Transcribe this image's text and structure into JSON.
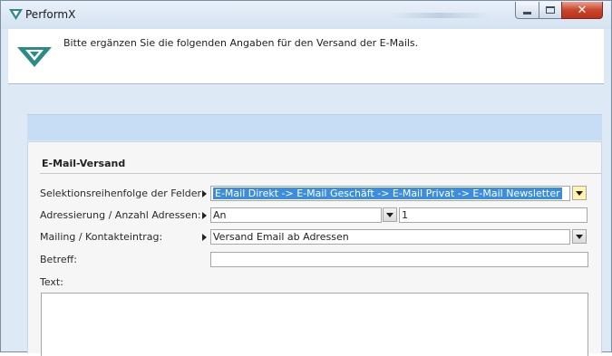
{
  "window": {
    "title": "PerformX",
    "icon": "performx-logo-icon",
    "buttons": [
      "minimize-icon",
      "maximize-icon",
      "close-icon"
    ],
    "close_color": "#c9462b"
  },
  "banner": {
    "message": "Bitte ergänzen Sie die folgenden Angaben für den Versand der E-Mails.",
    "logo": "performx-logo-icon",
    "logo_color": "#2d8a86"
  },
  "group": {
    "title": "E-Mail-Versand",
    "fields": {
      "selection": {
        "label": "Selektionsreihenfolge der Felder:",
        "value": "E-Mail Direkt -> E-Mail Geschäft -> E-Mail Privat -> E-Mail Newsletter"
      },
      "addressing": {
        "label": "Adressierung / Anzahl Adressen:",
        "value": "An",
        "count": "1"
      },
      "mailing": {
        "label": "Mailing / Kontakteintrag:",
        "value": "Versand Email ab Adressen"
      },
      "subject": {
        "label": "Betreff:",
        "value": ""
      },
      "text": {
        "label": "Text:",
        "value": ""
      }
    }
  },
  "colors": {
    "selection_highlight": "#3c8ddb",
    "dropdown_highlight": "#fff4b0",
    "band": "#c6ddf5"
  }
}
